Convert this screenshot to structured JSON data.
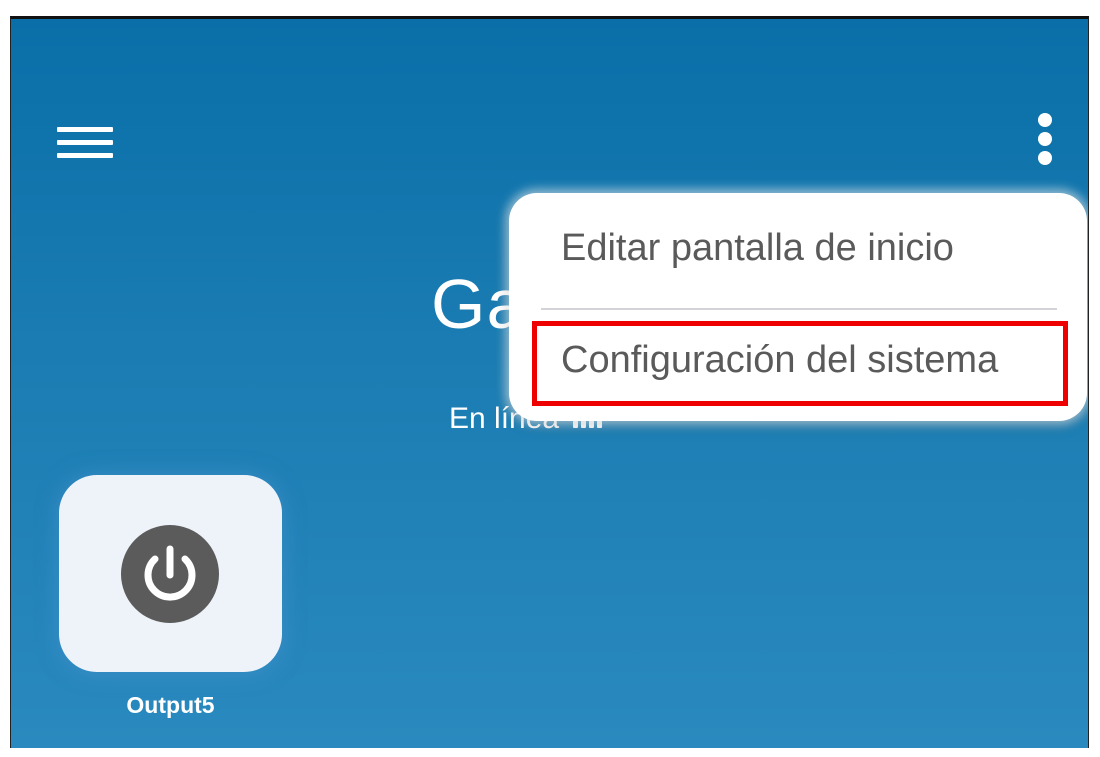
{
  "header": {
    "menu_icon": "hamburger-menu-icon",
    "overflow_icon": "vertical-ellipsis-icon"
  },
  "device": {
    "title": "Ga",
    "status_text": "En línea",
    "signal_icon": "signal-strength-icon"
  },
  "tiles": [
    {
      "label": "Output5",
      "icon": "power-icon"
    }
  ],
  "overflow_menu": {
    "items": [
      {
        "label": "Editar pantalla de inicio"
      },
      {
        "label": "Configuración del sistema"
      }
    ]
  },
  "colors": {
    "background_top": "#0a6fa8",
    "background_bottom": "#2a8abf",
    "highlight": "#ee0000",
    "menu_text": "#5a5a5a"
  }
}
